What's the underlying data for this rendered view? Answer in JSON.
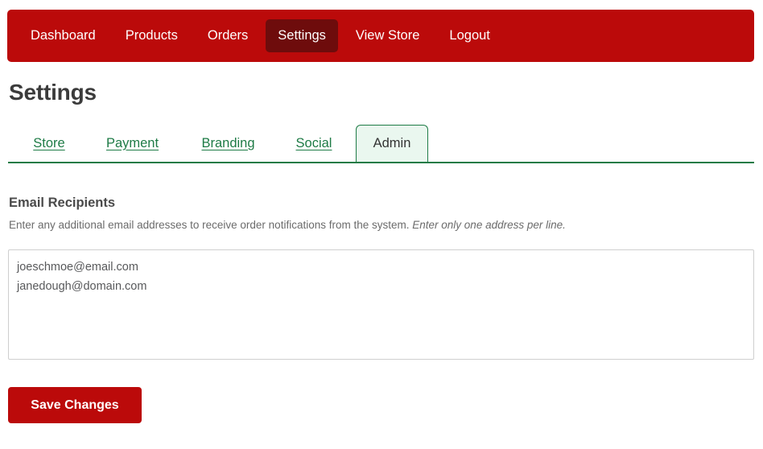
{
  "colors": {
    "brand_red": "#bb0a0a",
    "brand_red_active": "#6e0c0c",
    "accent_green": "#1e7b46",
    "tab_active_bg": "#eaf7ef",
    "heading_gray": "#3b3b3b",
    "body_gray": "#6b6b6b",
    "border_gray": "#cfcfcf"
  },
  "navbar": {
    "items": [
      {
        "label": "Dashboard",
        "active": false
      },
      {
        "label": "Products",
        "active": false
      },
      {
        "label": "Orders",
        "active": false
      },
      {
        "label": "Settings",
        "active": true
      },
      {
        "label": "View Store",
        "active": false
      },
      {
        "label": "Logout",
        "active": false
      }
    ]
  },
  "page": {
    "title": "Settings"
  },
  "tabs": {
    "items": [
      {
        "label": "Store",
        "active": false
      },
      {
        "label": "Payment",
        "active": false
      },
      {
        "label": "Branding",
        "active": false
      },
      {
        "label": "Social",
        "active": false
      },
      {
        "label": "Admin",
        "active": true
      }
    ]
  },
  "section": {
    "heading": "Email Recipients",
    "description_plain": "Enter any additional email addresses to receive order notifications from the system.",
    "description_emphasis": "Enter only one address per line."
  },
  "email_recipients": {
    "value": "joeschmoe@email.com\njanedough@domain.com",
    "placeholder": ""
  },
  "actions": {
    "save_label": "Save Changes"
  }
}
